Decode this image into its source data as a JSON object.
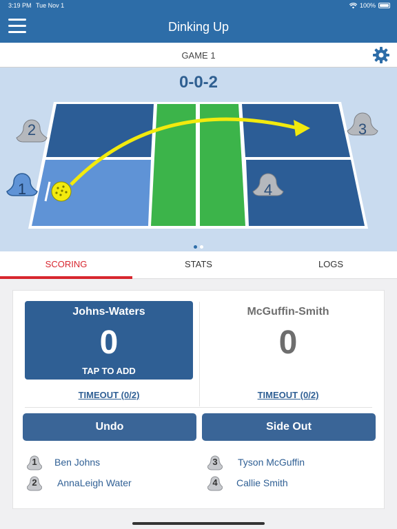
{
  "status_bar": {
    "time": "3:19 PM",
    "date": "Tue Nov 1",
    "battery": "100%"
  },
  "nav": {
    "title": "Dinking Up"
  },
  "game_bar": {
    "label": "GAME 1"
  },
  "court": {
    "score_call": "0-0-2",
    "positions": [
      "1",
      "2",
      "3",
      "4"
    ]
  },
  "tabs": [
    {
      "label": "SCORING",
      "active": true
    },
    {
      "label": "STATS",
      "active": false
    },
    {
      "label": "LOGS",
      "active": false
    }
  ],
  "scoring": {
    "team_left": {
      "name": "Johns-Waters",
      "score": "0",
      "hint": "TAP TO ADD",
      "timeout": "TIMEOUT (0/2)"
    },
    "team_right": {
      "name": "McGuffin-Smith",
      "score": "0",
      "timeout": "TIMEOUT (0/2)"
    },
    "undo_label": "Undo",
    "sideout_label": "Side Out",
    "players": [
      {
        "number": "1",
        "name": "Ben Johns"
      },
      {
        "number": "2",
        "name": "AnnaLeigh Water"
      },
      {
        "number": "3",
        "name": "Tyson McGuffin"
      },
      {
        "number": "4",
        "name": "Callie Smith"
      }
    ]
  },
  "colors": {
    "primary": "#2d6da8",
    "team_fill": "#2f5f94",
    "accent_red": "#d7262e",
    "court_blue": "#2c5d96",
    "kitchen_green": "#3cb44a",
    "ball_yellow": "#f2ea0e"
  }
}
